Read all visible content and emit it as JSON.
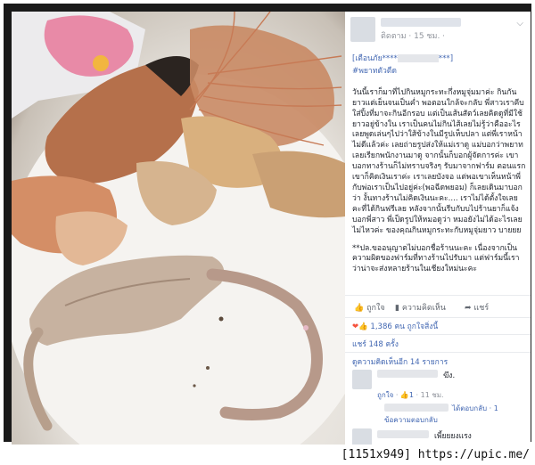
{
  "post": {
    "meta": "ติดตาม · 15 ชม. ·",
    "headline_open": "[เตือนภัย****",
    "headline_close": "***]",
    "hashtag": "#พยาทตัวตืด",
    "paragraph": "วันนี้เราก็มาที่ไปกินหมูกระทะกึ่งหมูจุ่มมาค่ะ กินกันยาวแต่เย็นจนเป็นค่ำ พอตอนใกล้จะกลับ พี่สาวเราคีบใส่ปิ้งที่มาจะกินอีกรอบ แต่เป็นเส้นสัตว์เลยคิดดูที่มีใช้ยาวอยู่ข้างใน เราเป็นคนไม่กินไส้เลยไม่รู้ว่าคืออะไรเลยพูดเล่นๆไปว่าใส้ข้างในมีรูปเห็บปลา แต่พี่เราหน้าไม่ดีแล้วค่ะ เลยถ่ายรูปส่งให้แม่เราดู แม่บอกว่าพยาท เลยเรียกพนักงานมาดู จากนั้นก็บอกผู้จัดการค่ะ เขาบอกทางร้านก็ไม่ทราบจริงๆ รับมาจากฟาร์ม ตอนแรกเขาก็คิดเงินเราค่ะ เราเลยบังจอ แต่พอเขาเห็นหน้าพี่กับพ่อเราเป็นไปอยู่ค่ะ(พอฉีดพยอม) ก็เลยเดินมาบอกว่า งั้นทางร้านไม่คิดเงินนะคะ.... เราไม่ได้ตั้งใจเลยคะที่ได้กินฟรีเลย หลังจากนั้นรีบกับบไปร้านยาก็แจ้งบอกพี่สาว พี่เป็ดรูปให้หมอดูว่า หมอยังไม่ได้อะไรเลย ไม่ไหวค่ะ ของคุณกินหมูกระทะกับหมูจุ่มยาว บายยย",
    "note": "**ปล.ขออนุญาตไม่บอกชื่อร้านนะคะ เนื่องจากเป็นความผิดของฟาร์มที่ทางร้านไปรับมา แต่ฟาร์มนี้เราว่าน่าจะส่งหลายร้านในเชียงใหม่นะคะ"
  },
  "actions": {
    "like": "ถูกใจ",
    "comment": "ความคิดเห็น",
    "share": "แชร์"
  },
  "stats": {
    "reactions": "1,386 คน ถูกใจสิ่งนี้",
    "shares": "แชร์ 148 ครั้ง",
    "view_comments": "ดูความคิดเห็นอีก 14 รายการ"
  },
  "comments": [
    {
      "text": "ฆึง.",
      "like_label": "ถูกใจ",
      "like_count": "1",
      "time": "11 ชม."
    }
  ],
  "reply": {
    "suffix": "ได้ตอบกลับ · 1",
    "label": "ข้อความตอบกลับ"
  },
  "comment2": {
    "text": "เพี้ยยยงแรง"
  },
  "watermark": {
    "text": "[1151x949] https://upic.me/"
  },
  "colors": {
    "link": "#4267b2",
    "frame": "#1a1a1a"
  }
}
